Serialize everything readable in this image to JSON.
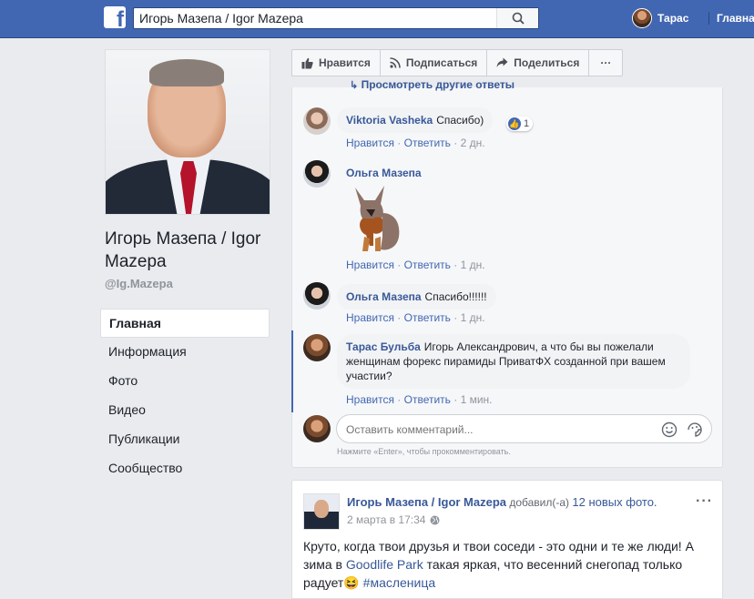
{
  "topbar": {
    "logo": "f",
    "search_value": "Игорь Мазепа / Igor Mazepa",
    "user_name": "Тарас",
    "nav_home": "Главна"
  },
  "profile": {
    "name": "Игорь Мазепа / Igor Mazepa",
    "handle": "@Ig.Mazepa"
  },
  "menu": {
    "items": [
      "Главная",
      "Информация",
      "Фото",
      "Видео",
      "Публикации",
      "Сообщество"
    ],
    "active_index": 0
  },
  "actions": {
    "like": "Нравится",
    "follow": "Подписаться",
    "share": "Поделиться",
    "more": "···"
  },
  "comments": {
    "more_replies": "Просмотреть другие ответы",
    "like_label": "Нравится",
    "reply_label": "Ответить",
    "items": [
      {
        "author": "Viktoria Vasheka",
        "text": "Спасибо)",
        "time": "2 дн.",
        "reactions": "1"
      },
      {
        "author": "Ольга Мазепа",
        "text": "",
        "time": "1 дн.",
        "sticker": "fox-sticker"
      },
      {
        "author": "Ольга Мазепа",
        "text": "Спасибо!!!!!!",
        "time": "1 дн."
      },
      {
        "author": "Тарас Бульба",
        "text": "Игорь Александрович, а что бы вы пожелали женщинам форекс пирамиды ПриватФХ созданной при вашем участии?",
        "time": "1 мин."
      }
    ],
    "input_placeholder": "Оставить комментарий...",
    "hint": "Нажмите «Enter», чтобы прокомментировать."
  },
  "post": {
    "author": "Игорь Мазепа / Igor Mazepa",
    "action": "добавил(-а)",
    "photos": "12 новых фото.",
    "time": "2 марта в 17:34",
    "more": "···",
    "text_1": "Круто, когда твои друзья и твои соседи - это одни и те же люди! А зима в ",
    "link": "Goodlife Park",
    "text_2": " такая яркая, что весенний снегопад только радует",
    "hashtag": "#масленица"
  },
  "colors": {
    "brand": "#4267b2",
    "link": "#385898",
    "background": "#e9ebee"
  }
}
